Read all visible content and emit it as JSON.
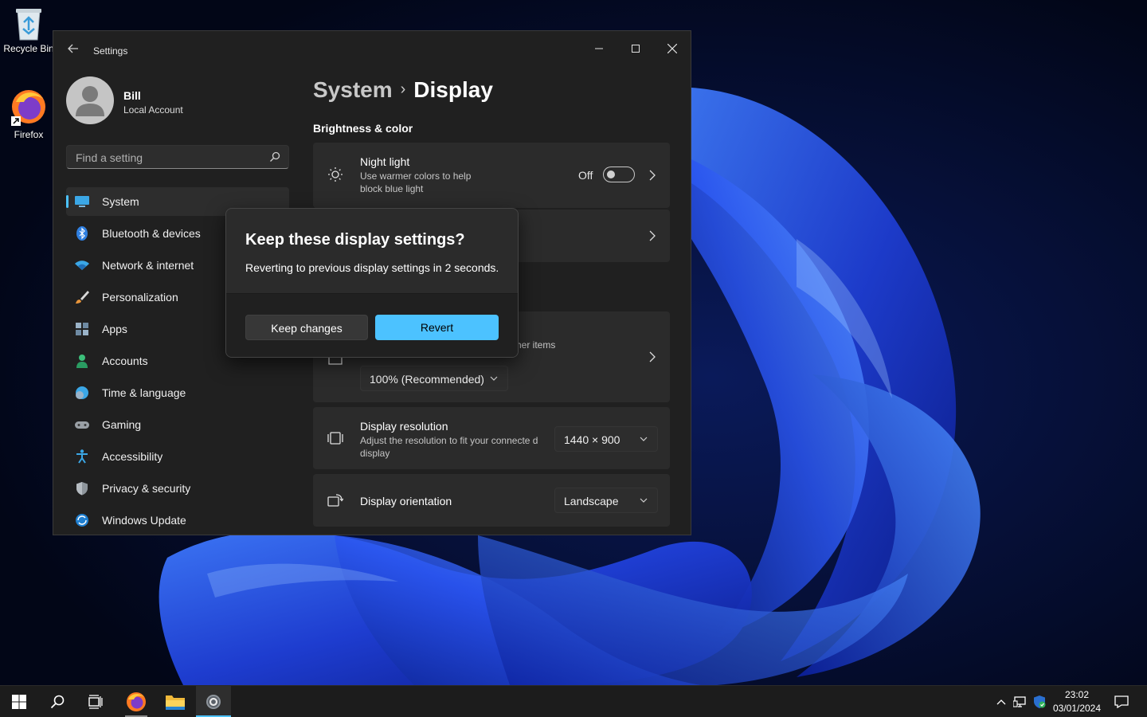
{
  "desktop": {
    "icons": [
      {
        "label": "Recycle Bin"
      },
      {
        "label": "Firefox"
      }
    ]
  },
  "window": {
    "title": "Settings",
    "user": {
      "name": "Bill",
      "account_type": "Local Account"
    },
    "search": {
      "placeholder": "Find a setting"
    },
    "nav": [
      {
        "label": "System",
        "icon": "monitor-icon",
        "active": true
      },
      {
        "label": "Bluetooth & devices",
        "icon": "bluetooth-icon"
      },
      {
        "label": "Network & internet",
        "icon": "wifi-icon"
      },
      {
        "label": "Personalization",
        "icon": "brush-icon"
      },
      {
        "label": "Apps",
        "icon": "apps-icon"
      },
      {
        "label": "Accounts",
        "icon": "person-icon"
      },
      {
        "label": "Time & language",
        "icon": "globe-clock-icon"
      },
      {
        "label": "Gaming",
        "icon": "gamepad-icon"
      },
      {
        "label": "Accessibility",
        "icon": "accessibility-icon"
      },
      {
        "label": "Privacy & security",
        "icon": "shield-icon"
      },
      {
        "label": "Windows Update",
        "icon": "refresh-icon"
      }
    ],
    "breadcrumb": {
      "parent": "System",
      "separator": "›",
      "current": "Display"
    },
    "section": "Brightness & color",
    "night_light": {
      "title": "Night light",
      "description": "Use warmer colors to help block blue light",
      "state": "Off"
    },
    "scale": {
      "description_fragment": "her items",
      "value": "100% (Recommended)"
    },
    "resolution": {
      "title": "Display resolution",
      "description": "Adjust the resolution to fit your connecte d display",
      "value": "1440 × 900"
    },
    "orientation": {
      "title": "Display orientation",
      "value": "Landscape"
    }
  },
  "dialog": {
    "title": "Keep these display settings?",
    "message": "Reverting to previous display settings in  2 seconds.",
    "keep_label": "Keep changes",
    "revert_label": "Revert"
  },
  "taskbar": {
    "time": "23:02",
    "date": "03/01/2024"
  },
  "colors": {
    "accent": "#4cc2ff",
    "window_bg": "#202020",
    "card_bg": "#2b2b2b",
    "desktop_bg": "#03081e"
  }
}
